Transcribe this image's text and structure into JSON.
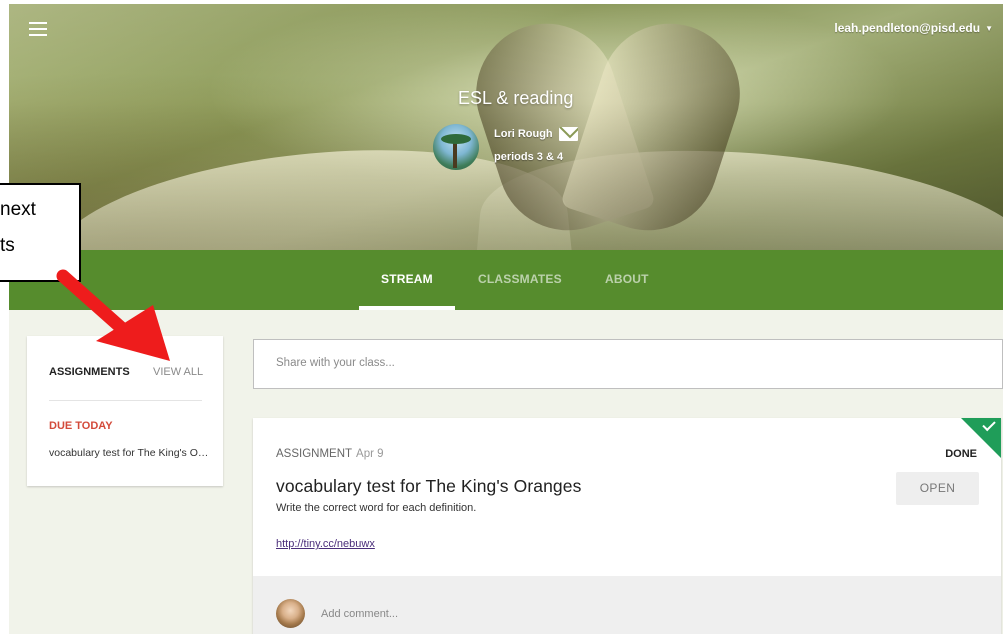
{
  "header": {
    "user_email": "leah.pendleton@pisd.edu",
    "class_title": "ESL & reading",
    "teacher_name": "Lori Rough",
    "class_section": "periods 3 & 4"
  },
  "nav": {
    "tabs": [
      {
        "label": "STREAM"
      },
      {
        "label": "CLASSMATES"
      },
      {
        "label": "ABOUT"
      }
    ]
  },
  "assignments": {
    "heading": "ASSIGNMENTS",
    "view_all": "VIEW ALL",
    "due_label": "DUE TODAY",
    "due_item": "vocabulary test for The King's Oranges"
  },
  "share": {
    "placeholder": "Share with your class..."
  },
  "post": {
    "type": "ASSIGNMENT",
    "date": "Apr 9",
    "status": "DONE",
    "title": "vocabulary test for The King's Oranges",
    "description": "Write the correct word for each definition.",
    "link": "http://tiny.cc/nebuwx",
    "open_label": "OPEN",
    "comment_placeholder": "Add comment..."
  },
  "callout": {
    "line1": "next",
    "line2": "ts"
  },
  "colors": {
    "accent_green": "#568c2d",
    "done_green": "#1f9d59",
    "due_red": "#d34a3a",
    "arrow_red": "#ee1c1c"
  }
}
